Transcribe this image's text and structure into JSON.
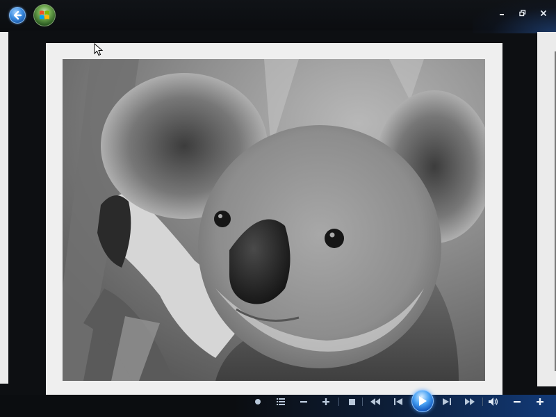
{
  "top_bar": {
    "back_icon": "back-arrow-icon",
    "start_icon": "windows-start-orb-icon",
    "window_controls": [
      "minimize-icon",
      "restore-icon",
      "close-icon"
    ]
  },
  "viewer": {
    "photo_subject_icon": "koala-photo"
  },
  "controls": {
    "icons": [
      "slideshow-icon",
      "settings-icon",
      "zoom-out-icon",
      "zoom-in-icon",
      "stop-icon",
      "rewind-icon",
      "previous-icon",
      "play-icon",
      "next-icon",
      "fast-forward-icon",
      "volume-icon",
      "volume-down-icon",
      "volume-up-icon"
    ]
  },
  "colors": {
    "background": "#0d0f12",
    "frame": "#efefef",
    "accent": "#3a8be0"
  }
}
